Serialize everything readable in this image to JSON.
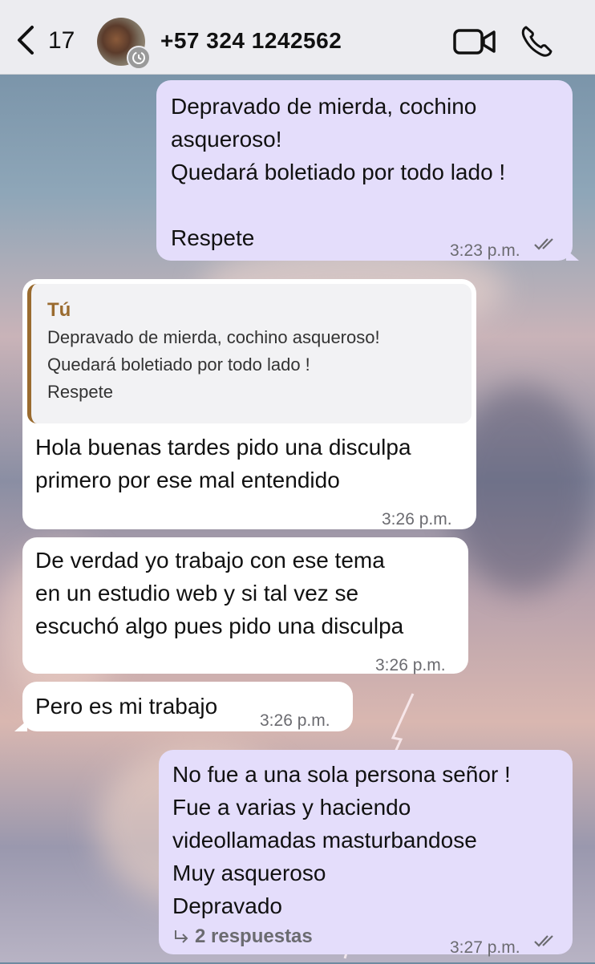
{
  "header": {
    "back_count": "17",
    "contact_name": "+57 324 1242562",
    "icons": {
      "back": "chevron-left-icon",
      "video": "video-camera-icon",
      "call": "phone-icon",
      "avatar_badge": "disappearing-timer-icon"
    }
  },
  "messages": [
    {
      "direction": "outgoing",
      "lines": [
        "Depravado de mierda, cochino",
        "asqueroso!",
        "Quedará boletiado por todo lado !",
        "",
        "Respete"
      ],
      "time": "3:23 p.m.",
      "status": "read"
    },
    {
      "direction": "incoming",
      "quote": {
        "author": "Tú",
        "lines": [
          "Depravado de mierda, cochino asqueroso!",
          "Quedará boletiado por todo lado !",
          "Respete"
        ]
      },
      "lines": [
        "Hola buenas tardes pido una disculpa",
        "primero por ese mal entendido"
      ],
      "time": "3:26 p.m."
    },
    {
      "direction": "incoming",
      "lines": [
        "De verdad yo trabajo con ese tema",
        "en un estudio web y si tal vez se",
        "escuchó algo pues pido una disculpa"
      ],
      "time": "3:26 p.m."
    },
    {
      "direction": "incoming",
      "lines": [
        "Pero es mi trabajo"
      ],
      "time": "3:26 p.m."
    },
    {
      "direction": "outgoing",
      "lines": [
        "No fue a una sola persona señor !",
        "Fue a varias y haciendo",
        "videollamadas masturbandose",
        "Muy asqueroso",
        "Depravado"
      ],
      "replies": "2 respuestas",
      "time": "3:27 p.m.",
      "status": "read"
    }
  ],
  "colors": {
    "outgoing_bubble": "#e4ddfb",
    "incoming_bubble": "#ffffff",
    "quote_accent": "#9a6b2f",
    "header_bg": "#ececf0"
  }
}
